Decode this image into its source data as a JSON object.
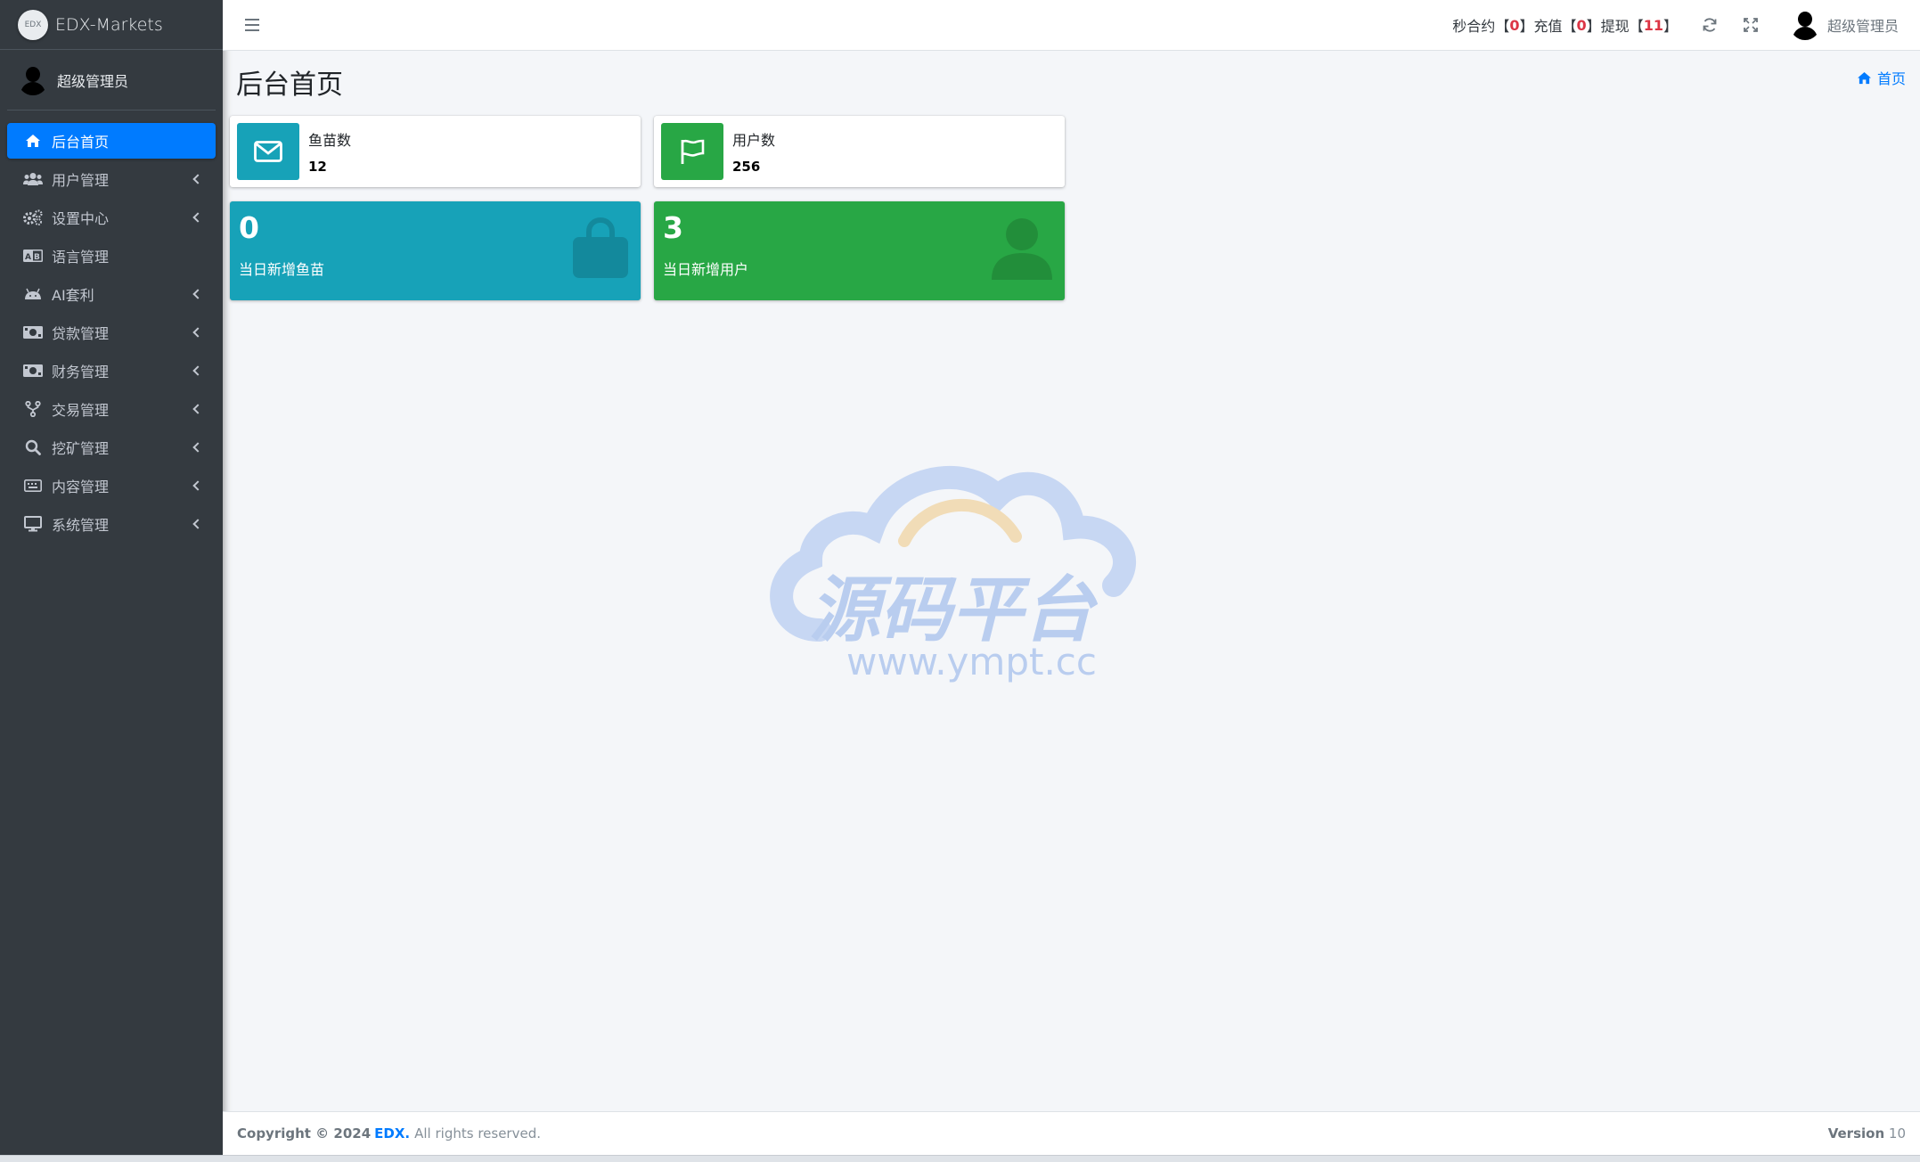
{
  "brand": {
    "logo_text": "EDX",
    "name": "EDX-Markets"
  },
  "sidebar_user": {
    "name": "超级管理员"
  },
  "nav": [
    {
      "label": "后台首页",
      "icon": "home-icon",
      "active": true,
      "has_children": false
    },
    {
      "label": "用户管理",
      "icon": "users-icon",
      "has_children": true
    },
    {
      "label": "设置中心",
      "icon": "cogs-icon",
      "has_children": true
    },
    {
      "label": "语言管理",
      "icon": "language-icon",
      "has_children": false
    },
    {
      "label": "AI套利",
      "icon": "android-icon",
      "has_children": true
    },
    {
      "label": "贷款管理",
      "icon": "money-icon",
      "has_children": true
    },
    {
      "label": "财务管理",
      "icon": "money-icon",
      "has_children": true
    },
    {
      "label": "交易管理",
      "icon": "fork-icon",
      "has_children": true
    },
    {
      "label": "挖矿管理",
      "icon": "search-icon",
      "has_children": true
    },
    {
      "label": "内容管理",
      "icon": "keyboard-icon",
      "has_children": true
    },
    {
      "label": "系统管理",
      "icon": "desktop-icon",
      "has_children": true
    }
  ],
  "header": {
    "stats": {
      "contract_label": "秒合约",
      "contract_count": "0",
      "recharge_label": "充值",
      "recharge_count": "0",
      "withdraw_label": "提现",
      "withdraw_count": "11",
      "bracket_open": "【",
      "bracket_close": "】"
    },
    "user_name": "超级管理员"
  },
  "page": {
    "title": "后台首页",
    "breadcrumb": "首页"
  },
  "info_boxes": [
    {
      "label": "鱼苗数",
      "value": "12",
      "color": "#17a2b8",
      "icon": "envelope-icon"
    },
    {
      "label": "用户数",
      "value": "256",
      "color": "#28a745",
      "icon": "flag-icon"
    }
  ],
  "small_boxes": [
    {
      "value": "0",
      "label": "当日新增鱼苗",
      "color": "#17a2b8",
      "icon": "shopping-bag-icon"
    },
    {
      "value": "3",
      "label": "当日新增用户",
      "color": "#28a745",
      "icon": "user-icon"
    }
  ],
  "watermark": {
    "text": "源码平台",
    "url": "www.ympt.cc"
  },
  "footer": {
    "copyright": "Copyright © 2024",
    "brand": "EDX.",
    "rights": "All rights reserved.",
    "version_label": "Version",
    "version": "10"
  }
}
